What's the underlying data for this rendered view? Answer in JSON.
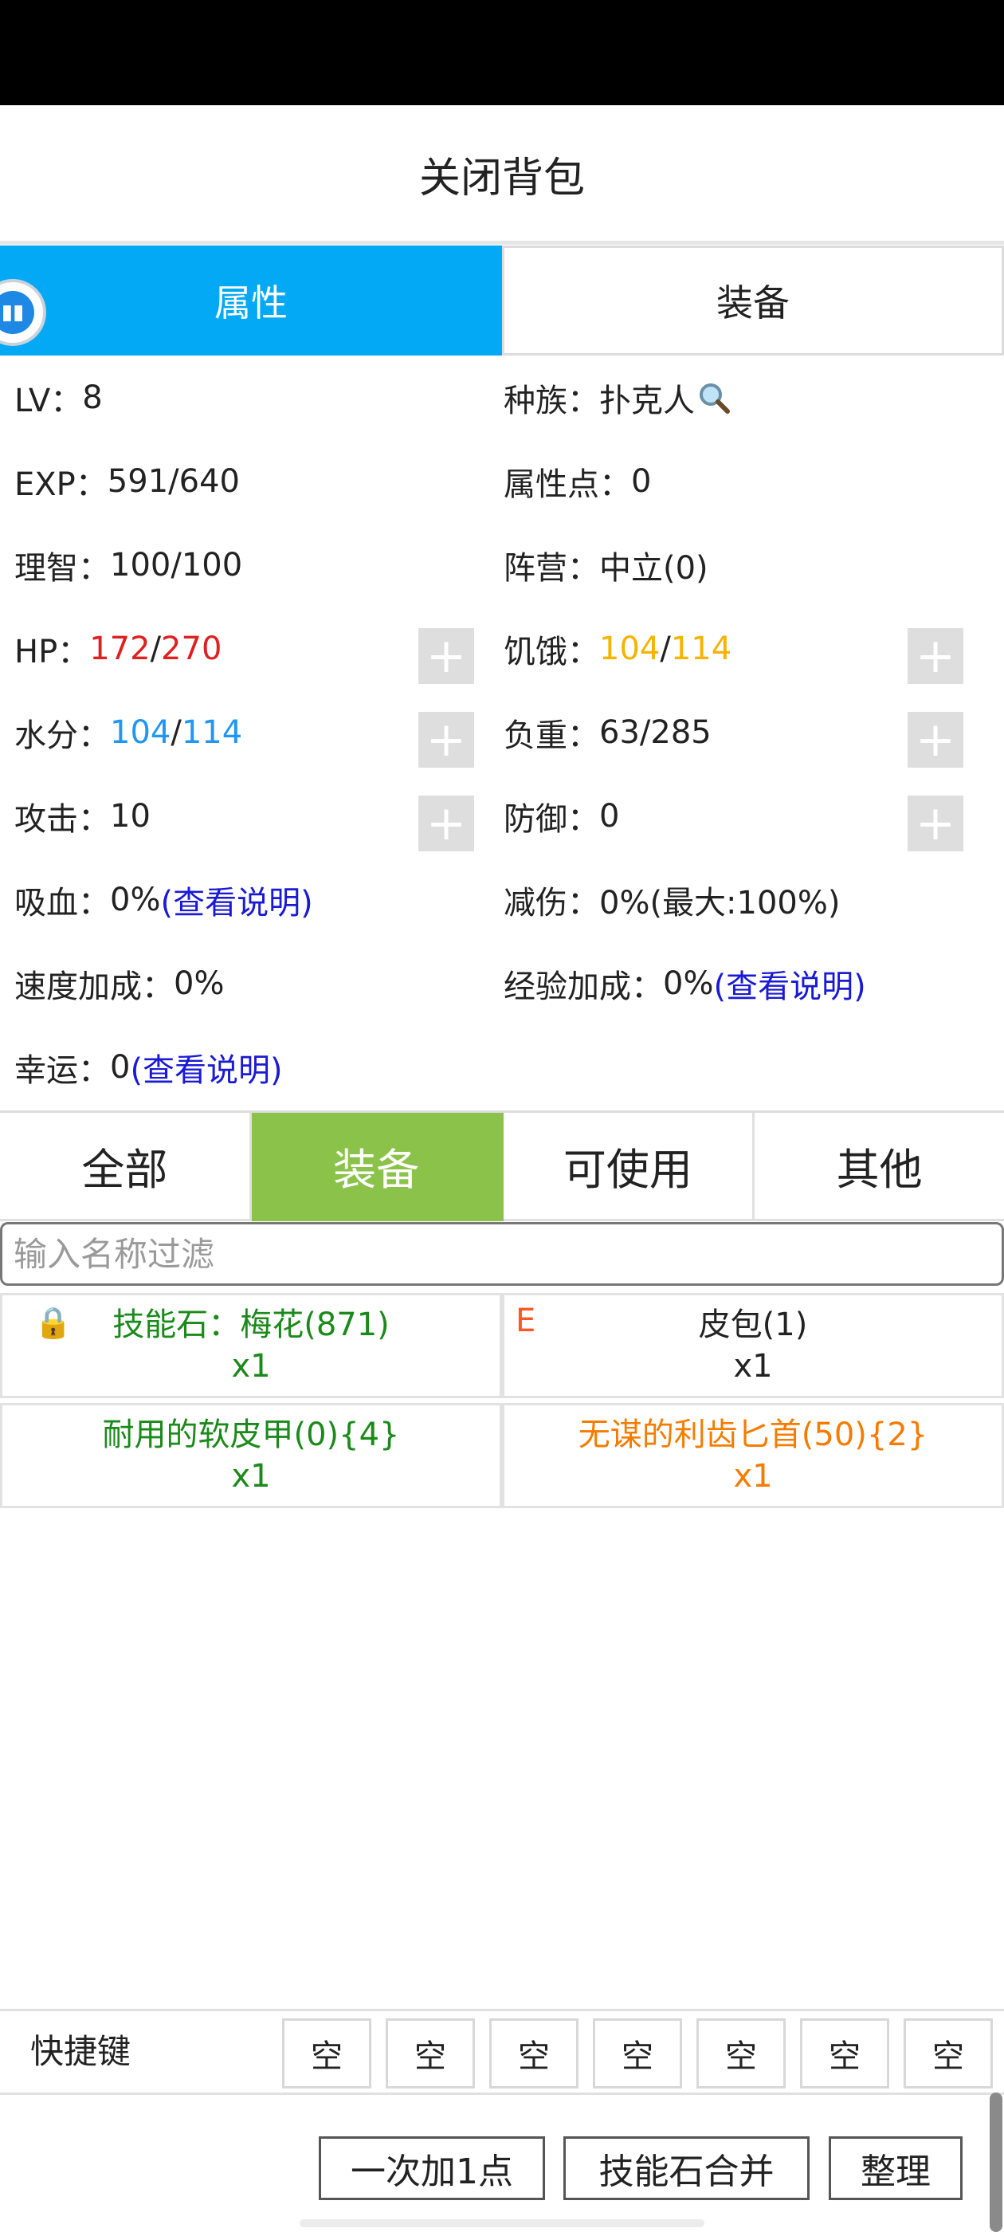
{
  "header": {
    "close_label": "关闭背包"
  },
  "main_tabs": [
    {
      "label": "属性",
      "active": true
    },
    {
      "label": "装备",
      "active": false
    }
  ],
  "stats": {
    "lv": {
      "label": "LV：",
      "value": "8"
    },
    "race": {
      "label": "种族：",
      "value": "扑克人",
      "icon": "search-icon"
    },
    "exp": {
      "label": "EXP：",
      "value": "591/640"
    },
    "attr_points": {
      "label": "属性点：",
      "value": "0"
    },
    "sanity": {
      "label": "理智：",
      "value": "100/100"
    },
    "faction": {
      "label": "阵营：",
      "value": "中立(0)"
    },
    "hp": {
      "label": "HP：",
      "current": "172",
      "sep": "/",
      "max": "270",
      "color": "#e02020"
    },
    "hunger": {
      "label": "饥饿：",
      "current": "104",
      "sep": "/",
      "max": "114",
      "color": "#f5b400"
    },
    "water": {
      "label": "水分：",
      "current": "104",
      "sep": "/",
      "max": "114",
      "color": "#2196f3"
    },
    "load": {
      "label": "负重：",
      "value": "63/285"
    },
    "attack": {
      "label": "攻击：",
      "value": "10"
    },
    "defense": {
      "label": "防御：",
      "value": "0"
    },
    "lifesteal": {
      "label": "吸血：",
      "value": "0%",
      "link": "(查看说明)"
    },
    "damage_reduction": {
      "label": "减伤：",
      "value": "0%(最大:100%)"
    },
    "speed_bonus": {
      "label": "速度加成：",
      "value": "0%"
    },
    "exp_bonus": {
      "label": "经验加成：",
      "value": "0%",
      "link": "(查看说明)"
    },
    "luck": {
      "label": "幸运：",
      "value": "0",
      "link": "(查看说明)"
    },
    "plus_symbol": "+"
  },
  "category_tabs": [
    {
      "label": "全部",
      "active": false
    },
    {
      "label": "装备",
      "active": true
    },
    {
      "label": "可使用",
      "active": false
    },
    {
      "label": "其他",
      "active": false
    }
  ],
  "filter": {
    "placeholder": "输入名称过滤",
    "value": ""
  },
  "items": [
    {
      "name": "技能石：梅花(871)",
      "qty": "x1",
      "color": "#1a8a1a",
      "locked": true,
      "lock_icon": "lock-icon"
    },
    {
      "name": "皮包(1)",
      "qty": "x1",
      "color": "#222222",
      "badge": "E"
    },
    {
      "name": "耐用的软皮甲(0){4}",
      "qty": "x1",
      "color": "#1a8a1a"
    },
    {
      "name": "无谋的利齿匕首(50){2}",
      "qty": "x1",
      "color": "#f57c00"
    }
  ],
  "quickbar": {
    "label": "快捷键",
    "slots": [
      "空",
      "空",
      "空",
      "空",
      "空",
      "空",
      "空"
    ]
  },
  "actions": {
    "add_one": "一次加1点",
    "merge_stones": "技能石合并",
    "sort": "整理"
  }
}
